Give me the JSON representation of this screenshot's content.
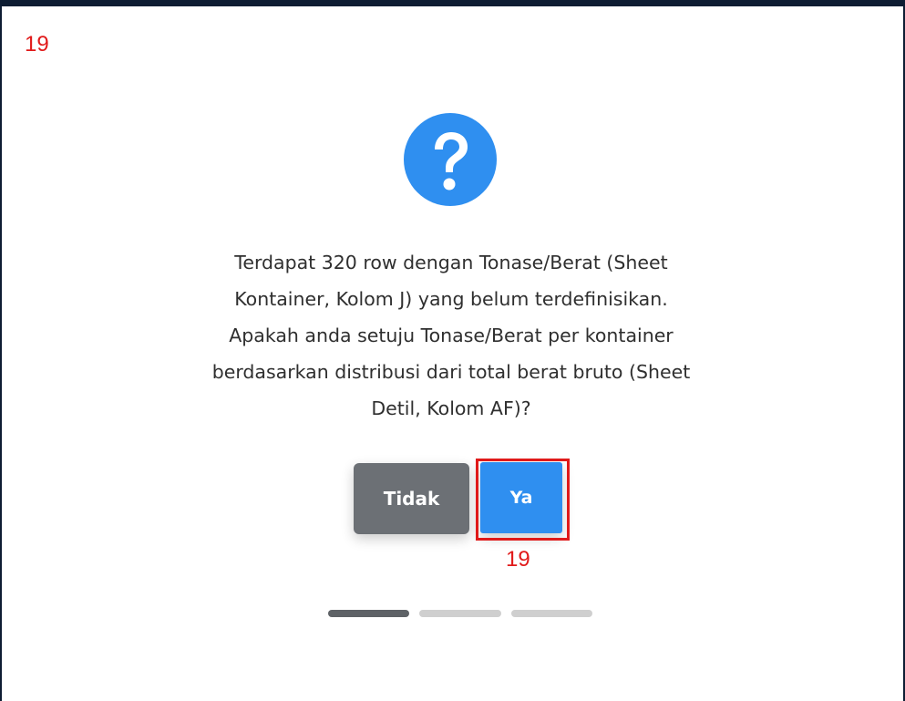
{
  "annotation": {
    "step_label_top": "19",
    "step_label_button": "19",
    "color": "#e11a1a"
  },
  "dialog": {
    "icon": "question-circle-icon",
    "icon_color": "#2f8ff0",
    "message_lines": [
      "Terdapat 320 row dengan Tonase/Berat (Sheet",
      "Kontainer, Kolom J) yang belum terdefinisikan.",
      "Apakah anda setuju Tonase/Berat per kontainer",
      "berdasarkan distribusi dari total berat bruto (Sheet",
      "Detil, Kolom AF)?"
    ],
    "cancel_label": "Tidak",
    "confirm_label": "Ya",
    "cancel_color": "#6c7075",
    "confirm_color": "#2f8ff0"
  },
  "progress_steps": {
    "total": 3,
    "current": 1
  }
}
